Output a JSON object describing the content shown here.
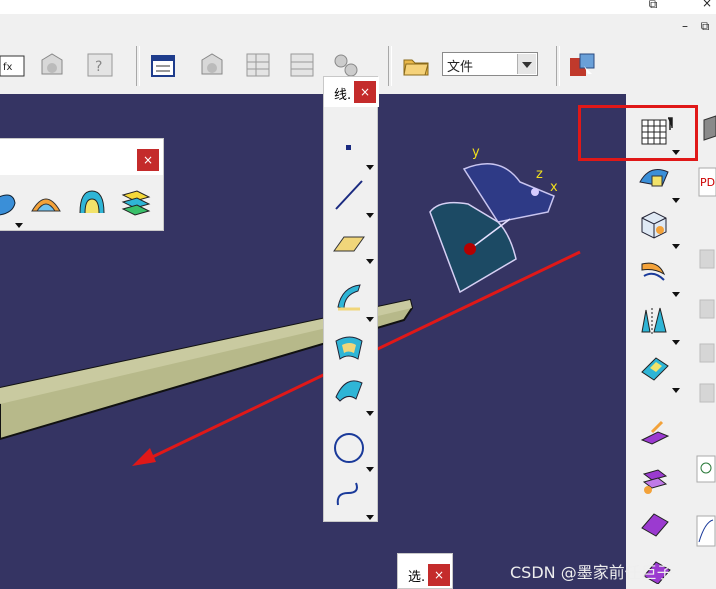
{
  "window": {
    "minimize_glyph": "–",
    "restore_glyph": "⧉",
    "close_glyph": "×"
  },
  "toolbar": {
    "file_combo_value": "文件",
    "icons": [
      "function-icon",
      "catalog-icon",
      "help-icon",
      "properties-icon",
      "catalog2-icon",
      "table-icon",
      "table2-icon",
      "gears-icon",
      "open-folder-icon",
      "package-icon"
    ]
  },
  "floating_left": {
    "close_glyph": "×",
    "icons": [
      "shape-icon",
      "dome-icon",
      "loft-icon",
      "stack-icon"
    ]
  },
  "floating_line": {
    "title": "线.",
    "close_glyph": "×",
    "icons": [
      "point-icon",
      "line-icon",
      "plane-icon",
      "surface-icon",
      "patch-icon",
      "sweep-icon",
      "circle-icon",
      "spline-icon"
    ]
  },
  "floating_select": {
    "title": "选.",
    "close_glyph": "×"
  },
  "compass": {
    "x_label": "x",
    "y_label": "y",
    "z_label": "z"
  },
  "right_toolbar": {
    "icons": [
      "grid-icon",
      "wizard-icon",
      "axis-icon",
      "curve-icon",
      "split-icon",
      "fill-icon",
      "cube-icon",
      "pdf-icon",
      "coin-icon"
    ]
  },
  "watermark": "CSDN @墨家前任巨子",
  "colors": {
    "viewport_bg": "#353463",
    "highlight": "#e01818",
    "close_red": "#c42b2b",
    "part": "#b7b98a"
  }
}
